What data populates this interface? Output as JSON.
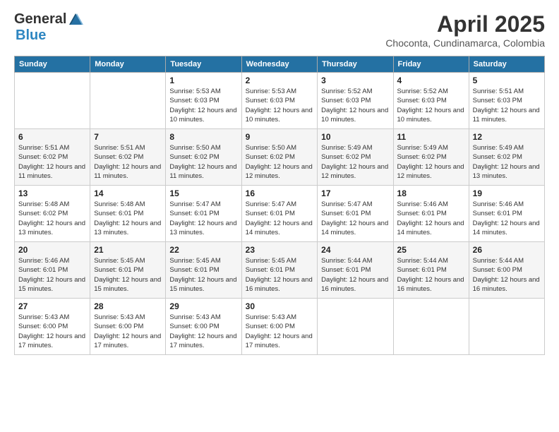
{
  "logo": {
    "general": "General",
    "blue": "Blue"
  },
  "title": "April 2025",
  "subtitle": "Choconta, Cundinamarca, Colombia",
  "days_of_week": [
    "Sunday",
    "Monday",
    "Tuesday",
    "Wednesday",
    "Thursday",
    "Friday",
    "Saturday"
  ],
  "weeks": [
    [
      null,
      null,
      {
        "day": "1",
        "sunrise": "Sunrise: 5:53 AM",
        "sunset": "Sunset: 6:03 PM",
        "daylight": "Daylight: 12 hours and 10 minutes."
      },
      {
        "day": "2",
        "sunrise": "Sunrise: 5:53 AM",
        "sunset": "Sunset: 6:03 PM",
        "daylight": "Daylight: 12 hours and 10 minutes."
      },
      {
        "day": "3",
        "sunrise": "Sunrise: 5:52 AM",
        "sunset": "Sunset: 6:03 PM",
        "daylight": "Daylight: 12 hours and 10 minutes."
      },
      {
        "day": "4",
        "sunrise": "Sunrise: 5:52 AM",
        "sunset": "Sunset: 6:03 PM",
        "daylight": "Daylight: 12 hours and 10 minutes."
      },
      {
        "day": "5",
        "sunrise": "Sunrise: 5:51 AM",
        "sunset": "Sunset: 6:03 PM",
        "daylight": "Daylight: 12 hours and 11 minutes."
      }
    ],
    [
      {
        "day": "6",
        "sunrise": "Sunrise: 5:51 AM",
        "sunset": "Sunset: 6:02 PM",
        "daylight": "Daylight: 12 hours and 11 minutes."
      },
      {
        "day": "7",
        "sunrise": "Sunrise: 5:51 AM",
        "sunset": "Sunset: 6:02 PM",
        "daylight": "Daylight: 12 hours and 11 minutes."
      },
      {
        "day": "8",
        "sunrise": "Sunrise: 5:50 AM",
        "sunset": "Sunset: 6:02 PM",
        "daylight": "Daylight: 12 hours and 11 minutes."
      },
      {
        "day": "9",
        "sunrise": "Sunrise: 5:50 AM",
        "sunset": "Sunset: 6:02 PM",
        "daylight": "Daylight: 12 hours and 12 minutes."
      },
      {
        "day": "10",
        "sunrise": "Sunrise: 5:49 AM",
        "sunset": "Sunset: 6:02 PM",
        "daylight": "Daylight: 12 hours and 12 minutes."
      },
      {
        "day": "11",
        "sunrise": "Sunrise: 5:49 AM",
        "sunset": "Sunset: 6:02 PM",
        "daylight": "Daylight: 12 hours and 12 minutes."
      },
      {
        "day": "12",
        "sunrise": "Sunrise: 5:49 AM",
        "sunset": "Sunset: 6:02 PM",
        "daylight": "Daylight: 12 hours and 13 minutes."
      }
    ],
    [
      {
        "day": "13",
        "sunrise": "Sunrise: 5:48 AM",
        "sunset": "Sunset: 6:02 PM",
        "daylight": "Daylight: 12 hours and 13 minutes."
      },
      {
        "day": "14",
        "sunrise": "Sunrise: 5:48 AM",
        "sunset": "Sunset: 6:01 PM",
        "daylight": "Daylight: 12 hours and 13 minutes."
      },
      {
        "day": "15",
        "sunrise": "Sunrise: 5:47 AM",
        "sunset": "Sunset: 6:01 PM",
        "daylight": "Daylight: 12 hours and 13 minutes."
      },
      {
        "day": "16",
        "sunrise": "Sunrise: 5:47 AM",
        "sunset": "Sunset: 6:01 PM",
        "daylight": "Daylight: 12 hours and 14 minutes."
      },
      {
        "day": "17",
        "sunrise": "Sunrise: 5:47 AM",
        "sunset": "Sunset: 6:01 PM",
        "daylight": "Daylight: 12 hours and 14 minutes."
      },
      {
        "day": "18",
        "sunrise": "Sunrise: 5:46 AM",
        "sunset": "Sunset: 6:01 PM",
        "daylight": "Daylight: 12 hours and 14 minutes."
      },
      {
        "day": "19",
        "sunrise": "Sunrise: 5:46 AM",
        "sunset": "Sunset: 6:01 PM",
        "daylight": "Daylight: 12 hours and 14 minutes."
      }
    ],
    [
      {
        "day": "20",
        "sunrise": "Sunrise: 5:46 AM",
        "sunset": "Sunset: 6:01 PM",
        "daylight": "Daylight: 12 hours and 15 minutes."
      },
      {
        "day": "21",
        "sunrise": "Sunrise: 5:45 AM",
        "sunset": "Sunset: 6:01 PM",
        "daylight": "Daylight: 12 hours and 15 minutes."
      },
      {
        "day": "22",
        "sunrise": "Sunrise: 5:45 AM",
        "sunset": "Sunset: 6:01 PM",
        "daylight": "Daylight: 12 hours and 15 minutes."
      },
      {
        "day": "23",
        "sunrise": "Sunrise: 5:45 AM",
        "sunset": "Sunset: 6:01 PM",
        "daylight": "Daylight: 12 hours and 16 minutes."
      },
      {
        "day": "24",
        "sunrise": "Sunrise: 5:44 AM",
        "sunset": "Sunset: 6:01 PM",
        "daylight": "Daylight: 12 hours and 16 minutes."
      },
      {
        "day": "25",
        "sunrise": "Sunrise: 5:44 AM",
        "sunset": "Sunset: 6:01 PM",
        "daylight": "Daylight: 12 hours and 16 minutes."
      },
      {
        "day": "26",
        "sunrise": "Sunrise: 5:44 AM",
        "sunset": "Sunset: 6:00 PM",
        "daylight": "Daylight: 12 hours and 16 minutes."
      }
    ],
    [
      {
        "day": "27",
        "sunrise": "Sunrise: 5:43 AM",
        "sunset": "Sunset: 6:00 PM",
        "daylight": "Daylight: 12 hours and 17 minutes."
      },
      {
        "day": "28",
        "sunrise": "Sunrise: 5:43 AM",
        "sunset": "Sunset: 6:00 PM",
        "daylight": "Daylight: 12 hours and 17 minutes."
      },
      {
        "day": "29",
        "sunrise": "Sunrise: 5:43 AM",
        "sunset": "Sunset: 6:00 PM",
        "daylight": "Daylight: 12 hours and 17 minutes."
      },
      {
        "day": "30",
        "sunrise": "Sunrise: 5:43 AM",
        "sunset": "Sunset: 6:00 PM",
        "daylight": "Daylight: 12 hours and 17 minutes."
      },
      null,
      null,
      null
    ]
  ]
}
